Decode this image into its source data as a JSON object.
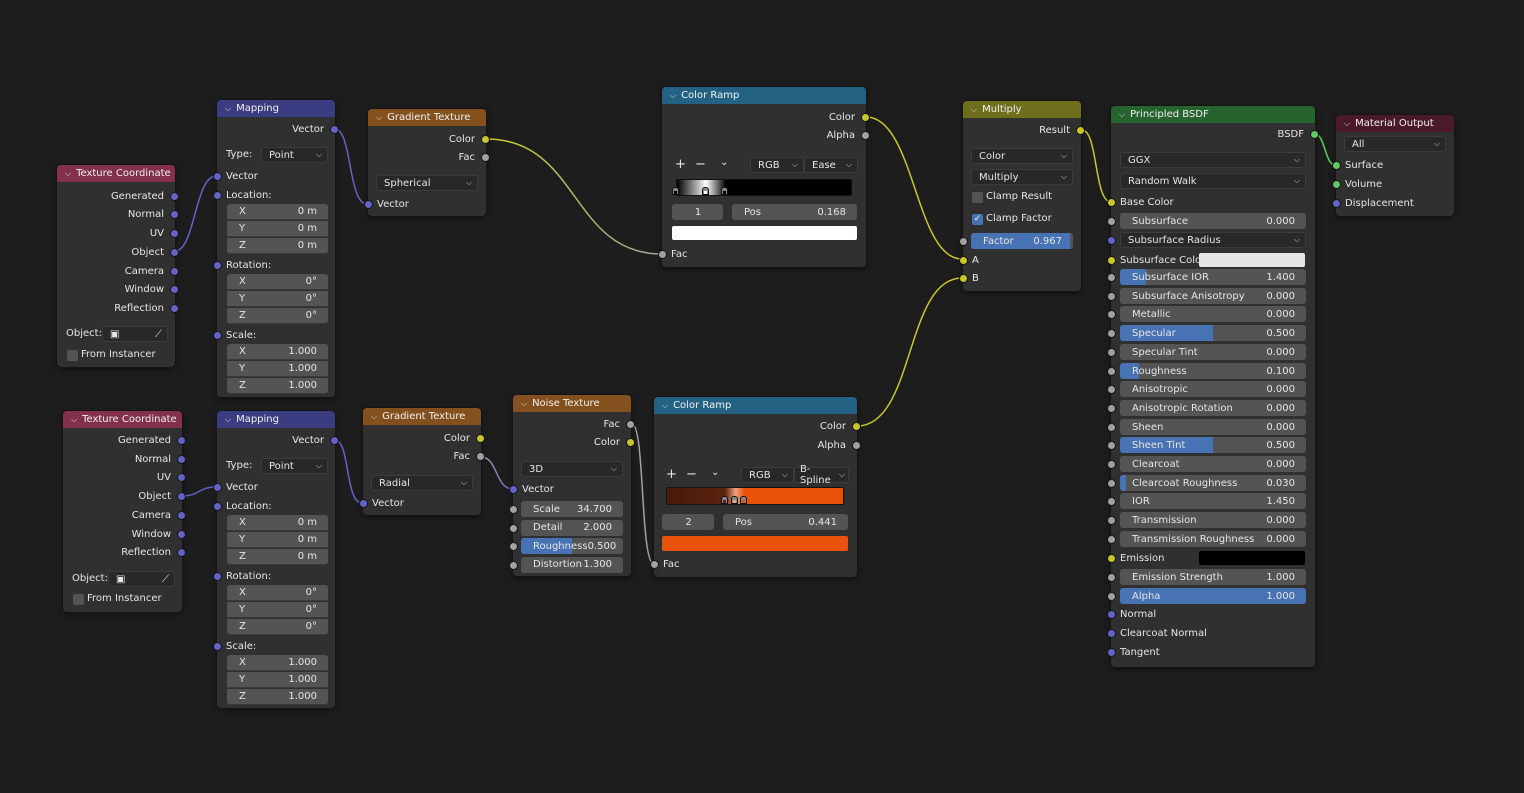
{
  "editor": "Shader Editor",
  "colors": {
    "background": "#1d1d1d",
    "header_input": "#83314a",
    "header_vector": "#3c3c83",
    "header_texture": "#83501e",
    "header_converter": "#246283",
    "header_color": "#6e6e1d",
    "header_shader": "#27632e",
    "header_output": "#4a1b26",
    "accent": "#4772b3",
    "socket_vector": "#6363c7",
    "socket_color": "#c7c729",
    "socket_float": "#a1a1a1",
    "socket_shader": "#63c763"
  },
  "texcoord1": {
    "title": "Texture Coordinate",
    "outputs": [
      "Generated",
      "Normal",
      "UV",
      "Object",
      "Camera",
      "Window",
      "Reflection"
    ],
    "object_label": "Object:",
    "from_instancer": "From Instancer"
  },
  "texcoord2": {
    "title": "Texture Coordinate",
    "outputs": [
      "Generated",
      "Normal",
      "UV",
      "Object",
      "Camera",
      "Window",
      "Reflection"
    ],
    "object_label": "Object:",
    "from_instancer": "From Instancer"
  },
  "mapping1": {
    "title": "Mapping",
    "output": "Vector",
    "type_label": "Type:",
    "type_value": "Point",
    "vector": "Vector",
    "location": "Location:",
    "loc": [
      {
        "axis": "X",
        "value": "0 m"
      },
      {
        "axis": "Y",
        "value": "0 m"
      },
      {
        "axis": "Z",
        "value": "0 m"
      }
    ],
    "rotation": "Rotation:",
    "rot": [
      {
        "axis": "X",
        "value": "0°"
      },
      {
        "axis": "Y",
        "value": "0°"
      },
      {
        "axis": "Z",
        "value": "0°"
      }
    ],
    "scale": "Scale:",
    "scl": [
      {
        "axis": "X",
        "value": "1.000"
      },
      {
        "axis": "Y",
        "value": "1.000"
      },
      {
        "axis": "Z",
        "value": "1.000"
      }
    ]
  },
  "mapping2": {
    "title": "Mapping",
    "output": "Vector",
    "type_label": "Type:",
    "type_value": "Point",
    "vector": "Vector",
    "location": "Location:",
    "loc": [
      {
        "axis": "X",
        "value": "0 m"
      },
      {
        "axis": "Y",
        "value": "0 m"
      },
      {
        "axis": "Z",
        "value": "0 m"
      }
    ],
    "rotation": "Rotation:",
    "rot": [
      {
        "axis": "X",
        "value": "0°"
      },
      {
        "axis": "Y",
        "value": "0°"
      },
      {
        "axis": "Z",
        "value": "0°"
      }
    ],
    "scale": "Scale:",
    "scl": [
      {
        "axis": "X",
        "value": "1.000"
      },
      {
        "axis": "Y",
        "value": "1.000"
      },
      {
        "axis": "Z",
        "value": "1.000"
      }
    ]
  },
  "gradient1": {
    "title": "Gradient Texture",
    "out_color": "Color",
    "out_fac": "Fac",
    "type_value": "Spherical",
    "in_vector": "Vector"
  },
  "gradient2": {
    "title": "Gradient Texture",
    "out_color": "Color",
    "out_fac": "Fac",
    "type_value": "Radial",
    "in_vector": "Vector"
  },
  "noise": {
    "title": "Noise Texture",
    "out_fac": "Fac",
    "out_color": "Color",
    "dimensions": "3D",
    "in_vector": "Vector",
    "fields": [
      {
        "label": "Scale",
        "value": "34.700",
        "fill": 0
      },
      {
        "label": "Detail",
        "value": "2.000",
        "fill": 0
      },
      {
        "label": "Roughness",
        "value": "0.500",
        "fill": 0.5
      },
      {
        "label": "Distortion",
        "value": "1.300",
        "fill": 0
      }
    ]
  },
  "ramp1": {
    "title": "Color Ramp",
    "out_color": "Color",
    "out_alpha": "Alpha",
    "plus": "+",
    "minus": "−",
    "more": "⌄",
    "color_mode": "RGB",
    "interpolation": "Ease",
    "active_index": "1",
    "pos_label": "Pos",
    "pos_value": "0.168",
    "active_color": "#ffffff",
    "stops": [
      {
        "pos": 0.0,
        "color": "#000000"
      },
      {
        "pos": 0.168,
        "color": "#ffffff"
      },
      {
        "pos": 0.28,
        "color": "#000000"
      }
    ],
    "in_fac": "Fac"
  },
  "ramp2": {
    "title": "Color Ramp",
    "out_color": "Color",
    "out_alpha": "Alpha",
    "plus": "+",
    "minus": "−",
    "more": "⌄",
    "color_mode": "RGB",
    "interpolation": "B-Spline",
    "active_index": "2",
    "pos_label": "Pos",
    "pos_value": "0.441",
    "active_color": "#e8520a",
    "stops": [
      {
        "pos": 0.0,
        "color": "#4a1a0a"
      },
      {
        "pos": 0.33,
        "color": "#5a2210"
      },
      {
        "pos": 0.39,
        "color": "#f0a080"
      },
      {
        "pos": 0.441,
        "color": "#e8520a"
      },
      {
        "pos": 1.0,
        "color": "#e8520a"
      }
    ],
    "in_fac": "Fac"
  },
  "multiply": {
    "title": "Multiply",
    "output": "Result",
    "data_type": "Color",
    "blend": "Multiply",
    "clamp_result": "Clamp Result",
    "clamp_result_checked": false,
    "clamp_factor": "Clamp Factor",
    "clamp_factor_checked": true,
    "factor_label": "Factor",
    "factor_value": "0.967",
    "factor_fill": 0.967,
    "in_a": "A",
    "in_b": "B"
  },
  "bsdf": {
    "title": "Principled BSDF",
    "output": "BSDF",
    "distribution": "GGX",
    "subsurface_method": "Random Walk",
    "base_color": "Base Color",
    "subsurface": {
      "label": "Subsurface",
      "value": "0.000",
      "fill": 0
    },
    "subsurface_radius": "Subsurface Radius",
    "subsurface_color": "Subsurface Color",
    "subsurface_color_value": "#e6e6e6",
    "fields": [
      {
        "label": "Subsurface IOR",
        "value": "1.400",
        "fill": 0.14
      },
      {
        "label": "Subsurface Anisotropy",
        "value": "0.000",
        "fill": 0
      },
      {
        "label": "Metallic",
        "value": "0.000",
        "fill": 0
      },
      {
        "label": "Specular",
        "value": "0.500",
        "fill": 0.5
      },
      {
        "label": "Specular Tint",
        "value": "0.000",
        "fill": 0
      },
      {
        "label": "Roughness",
        "value": "0.100",
        "fill": 0.1
      },
      {
        "label": "Anisotropic",
        "value": "0.000",
        "fill": 0
      },
      {
        "label": "Anisotropic Rotation",
        "value": "0.000",
        "fill": 0
      },
      {
        "label": "Sheen",
        "value": "0.000",
        "fill": 0
      },
      {
        "label": "Sheen Tint",
        "value": "0.500",
        "fill": 0.5
      },
      {
        "label": "Clearcoat",
        "value": "0.000",
        "fill": 0
      },
      {
        "label": "Clearcoat Roughness",
        "value": "0.030",
        "fill": 0.03
      },
      {
        "label": "IOR",
        "value": "1.450",
        "fill": 0
      },
      {
        "label": "Transmission",
        "value": "0.000",
        "fill": 0
      },
      {
        "label": "Transmission Roughness",
        "value": "0.000",
        "fill": 0
      }
    ],
    "emission": "Emission",
    "emission_value": "#000000",
    "emission_strength": {
      "label": "Emission Strength",
      "value": "1.000",
      "fill": 0
    },
    "alpha": {
      "label": "Alpha",
      "value": "1.000",
      "fill": 1
    },
    "normal": "Normal",
    "clearcoat_normal": "Clearcoat Normal",
    "tangent": "Tangent"
  },
  "output": {
    "title": "Material Output",
    "target": "All",
    "inputs": [
      "Surface",
      "Volume",
      "Displacement"
    ]
  }
}
